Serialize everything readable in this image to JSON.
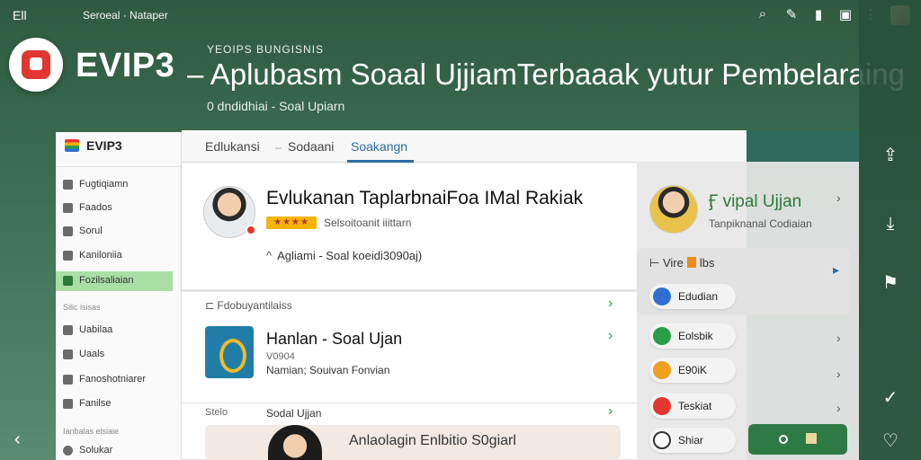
{
  "status_bar": {
    "carrier": "Ell",
    "text": "Seroeal · Nataper",
    "icons": [
      "search-icon",
      "pen-icon",
      "signal-icon",
      "calendar-icon",
      "more-icon"
    ]
  },
  "header": {
    "brand": "EVIP3",
    "kicker": "YEOIPS BUNGISNIS",
    "headline": "– Aplubasm Soaal UjjiamTerbaaak yutur Pembelaraing",
    "subline": "0 dndidhiai - Soal Upiarn"
  },
  "sidebar": {
    "title": "EVIP3",
    "items": [
      {
        "label": "Fugtiqiamn"
      },
      {
        "label": "Faados"
      },
      {
        "label": "Sorul"
      },
      {
        "label": "Kaniloniia"
      },
      {
        "label": "Fozilsaliaian",
        "active": true
      }
    ],
    "section1": "Silic isisas",
    "items2": [
      {
        "label": "Uabilaa"
      },
      {
        "label": "Uaals"
      },
      {
        "label": "Fanoshotniarer"
      },
      {
        "label": "Fanilse"
      }
    ],
    "section2": "Ianbalas elsiaie",
    "bottom_item": "Solukar"
  },
  "tabs": [
    {
      "label": "Edlukansi"
    },
    {
      "label": "Sodaani"
    },
    {
      "label": "Soakangn",
      "active": true
    }
  ],
  "card1": {
    "title": "Evlukanan TaplarbnaiFoa IMal Rakiak",
    "stars": "★★★★",
    "meta": "Selsoitoanit iiittarn",
    "sub": "Agliami - Soal koeidi3090aj)"
  },
  "card2": {
    "head": "Fdobuyantilaiss",
    "title": "Hanlan - Soal Ujan",
    "line1": "V0904",
    "line2": "Namian;  Souivan Fonvian"
  },
  "card3": {
    "head": "Stelo",
    "head2": "Sodal Ujjan",
    "promo": "Anlaolagin Enlbitio S0giarl"
  },
  "right_panel": {
    "title": "Ӻ vipal Ujjan",
    "sub": "Tanpiknanal Codiaian",
    "vire": "Vire",
    "vire_tail": "lbs",
    "pills": [
      {
        "label": "Edudian",
        "color": "#2f6fd0"
      },
      {
        "label": "Eolsbik",
        "color": "#2a9d4a"
      },
      {
        "label": "E90iK",
        "color": "#f0a020"
      },
      {
        "label": "Teskiat",
        "color": "#e33630"
      },
      {
        "label": "Shiar",
        "color": "#333333"
      }
    ]
  },
  "colors": {
    "accent_blue": "#2b6ea8",
    "accent_green": "#2b7a3a",
    "brand_red": "#e33630",
    "highlight": "#a9dfa4"
  }
}
